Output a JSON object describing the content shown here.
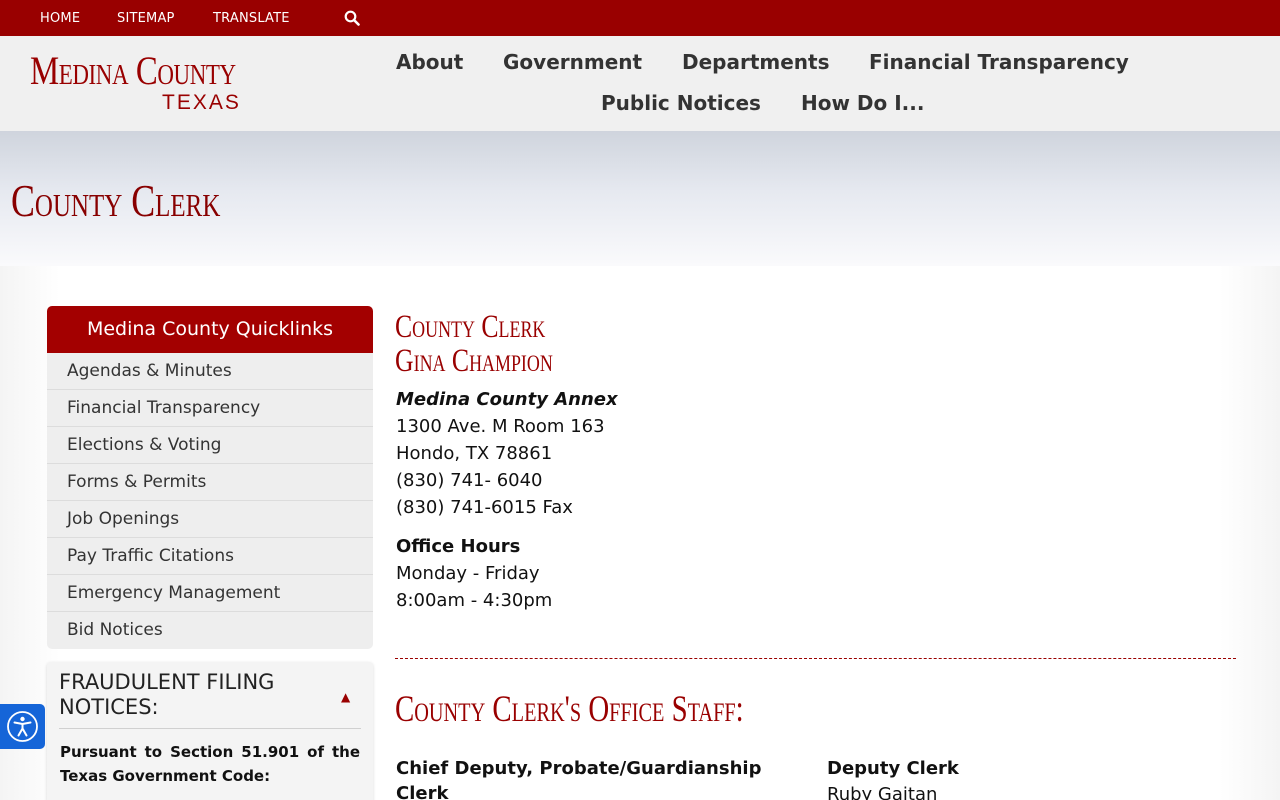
{
  "topbar": {
    "links": [
      "HOME",
      "SITEMAP",
      "TRANSLATE"
    ]
  },
  "logo": {
    "main": "Medina County",
    "sub": "TEXAS"
  },
  "nav": {
    "items": [
      "About",
      "Government",
      "Departments",
      "Financial Transparency",
      "Public Notices",
      "How Do I..."
    ]
  },
  "hero": {
    "title": "County Clerk"
  },
  "quicklinks": {
    "title": "Medina County Quicklinks",
    "items": [
      "Agendas & Minutes",
      "Financial Transparency",
      "Elections & Voting",
      "Forms & Permits",
      "Job Openings",
      "Pay Traffic Citations",
      "Emergency Management",
      "Bid Notices"
    ]
  },
  "fraud": {
    "title": "FRAUDULENT FILING NOTICES:",
    "caret": "▲",
    "text": "Pursuant to Section 51.901 of the Texas Government Code:"
  },
  "main": {
    "title_line1": "County Clerk",
    "title_line2": "Gina Champion",
    "annex": "Medina County Annex",
    "address": [
      "1300 Ave. M Room 163",
      "Hondo, TX 78861",
      "(830) 741- 6040",
      "(830) 741-6015 Fax"
    ],
    "hours_heading": "Office Hours",
    "hours": [
      "Monday - Friday",
      "8:00am - 4:30pm"
    ],
    "staff_heading": "County Clerk's Office Staff:",
    "staff": [
      {
        "role": "Chief Deputy, Probate/Guardianship Clerk",
        "name": ""
      },
      {
        "role": "Deputy Clerk",
        "name": "Ruby Gaitan"
      }
    ]
  },
  "colors": {
    "brand": "#990000",
    "accessibility": "#1565d8"
  }
}
